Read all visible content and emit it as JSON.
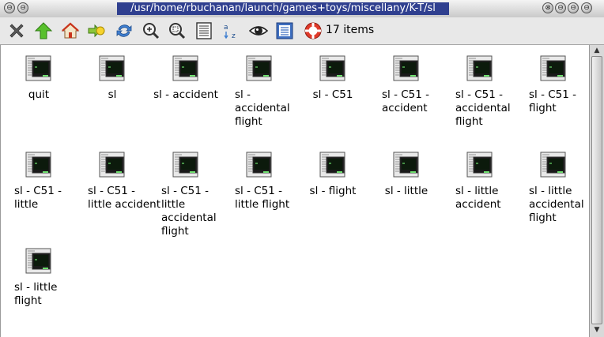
{
  "window": {
    "title": "/usr/home/rbuchanan/launch/games+toys/miscellany/K-T/sl",
    "left_buttons": [
      "⊖",
      "⊖"
    ],
    "right_buttons": [
      "⊗",
      "⊖",
      "⊖",
      "⊖"
    ]
  },
  "toolbar": {
    "tools": [
      {
        "name": "close-icon"
      },
      {
        "name": "up-icon"
      },
      {
        "name": "home-icon"
      },
      {
        "name": "goto-icon"
      },
      {
        "name": "refresh-icon"
      },
      {
        "name": "zoom-in-icon"
      },
      {
        "name": "zoom-fit-icon"
      },
      {
        "name": "details-view-icon"
      },
      {
        "name": "sort-icon"
      },
      {
        "name": "show-hidden-icon"
      },
      {
        "name": "select-icon"
      },
      {
        "name": "help-icon"
      }
    ],
    "status": "17 items"
  },
  "files": [
    {
      "label": "quit"
    },
    {
      "label": "sl"
    },
    {
      "label": "sl - accident"
    },
    {
      "label": "sl -\naccidental\nflight"
    },
    {
      "label": "sl - C51"
    },
    {
      "label": "sl - C51 -\naccident"
    },
    {
      "label": "sl - C51 -\naccidental\nflight"
    },
    {
      "label": "sl - C51 -\nflight"
    },
    {
      "label": "sl - C51 -\nlittle"
    },
    {
      "label": "sl - C51 -\nlittle accident"
    },
    {
      "label": "sl - C51 -\nlittle\naccidental\nflight"
    },
    {
      "label": "sl - C51 -\nlittle flight"
    },
    {
      "label": "sl - flight"
    },
    {
      "label": "sl - little"
    },
    {
      "label": "sl - little\naccident"
    },
    {
      "label": "sl - little\naccidental\nflight"
    },
    {
      "label": "sl - little\nflight"
    }
  ]
}
